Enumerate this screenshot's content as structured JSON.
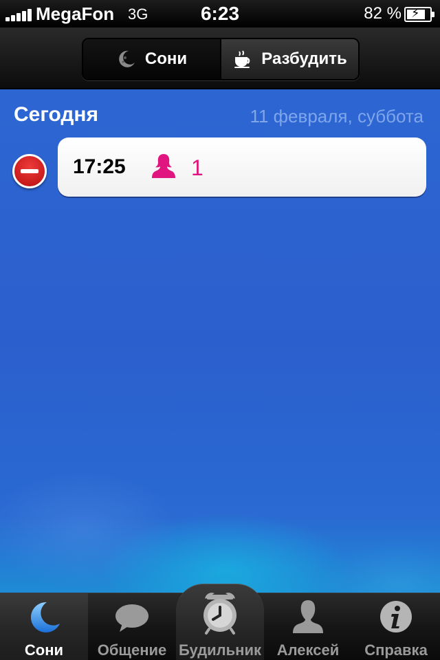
{
  "status_bar": {
    "carrier": "MegaFon",
    "network": "3G",
    "time": "6:23",
    "battery_percent": "82 %",
    "battery_level": 0.82
  },
  "nav": {
    "segments": [
      {
        "label": "Сони",
        "icon": "moon-icon",
        "selected": false
      },
      {
        "label": "Разбудить",
        "icon": "coffee-cup-icon",
        "selected": true
      }
    ]
  },
  "section": {
    "title": "Сегодня",
    "date": "11 февраля, суббота"
  },
  "alarms": [
    {
      "time": "17:25",
      "icon": "person-icon",
      "count": "1",
      "count_color": "#e0157f"
    }
  ],
  "tabs": [
    {
      "label": "Сони",
      "icon": "moon-icon",
      "active": true
    },
    {
      "label": "Общение",
      "icon": "speech-bubble-icon",
      "active": false
    },
    {
      "label": "Будильник",
      "icon": "alarm-clock-icon",
      "active": false
    },
    {
      "label": "Алексей",
      "icon": "user-icon",
      "active": false
    },
    {
      "label": "Справка",
      "icon": "info-icon",
      "active": false
    }
  ],
  "colors": {
    "background_blue": "#2b5fcd",
    "accent_pink": "#e0157f",
    "date_text": "#7fa6ea",
    "delete_red": "#d42020"
  }
}
